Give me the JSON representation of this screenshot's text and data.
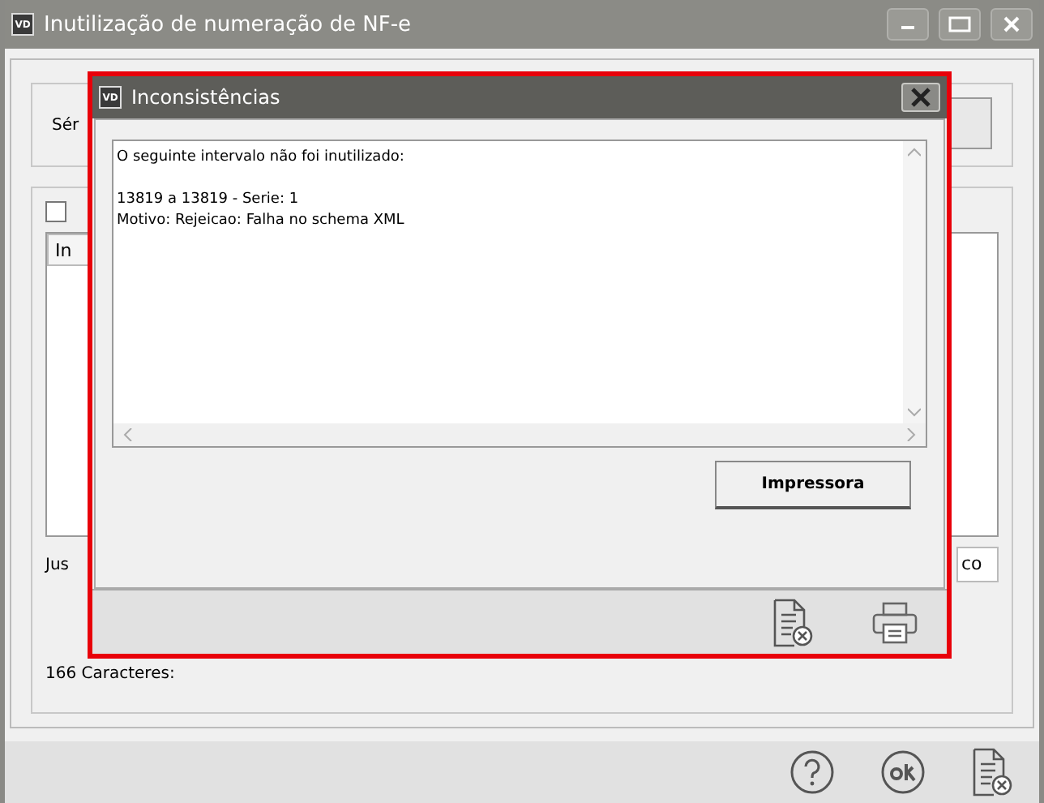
{
  "window": {
    "badge": "VD",
    "title": "Inutilização de numeração de NF-e"
  },
  "main": {
    "serie_label": "Sér",
    "checkbox": {
      "checked": false
    },
    "column_header": "In",
    "justificativa_label": "Jus",
    "justificativa_value": "co",
    "char_count": "166 Caracteres:"
  },
  "dialog": {
    "badge": "VD",
    "title": "Inconsistências",
    "message": "O seguinte intervalo não foi inutilizado:\n\n13819 a 13819 - Serie: 1\nMotivo: Rejeicao: Falha no schema XML",
    "print_button": "Impressora"
  }
}
